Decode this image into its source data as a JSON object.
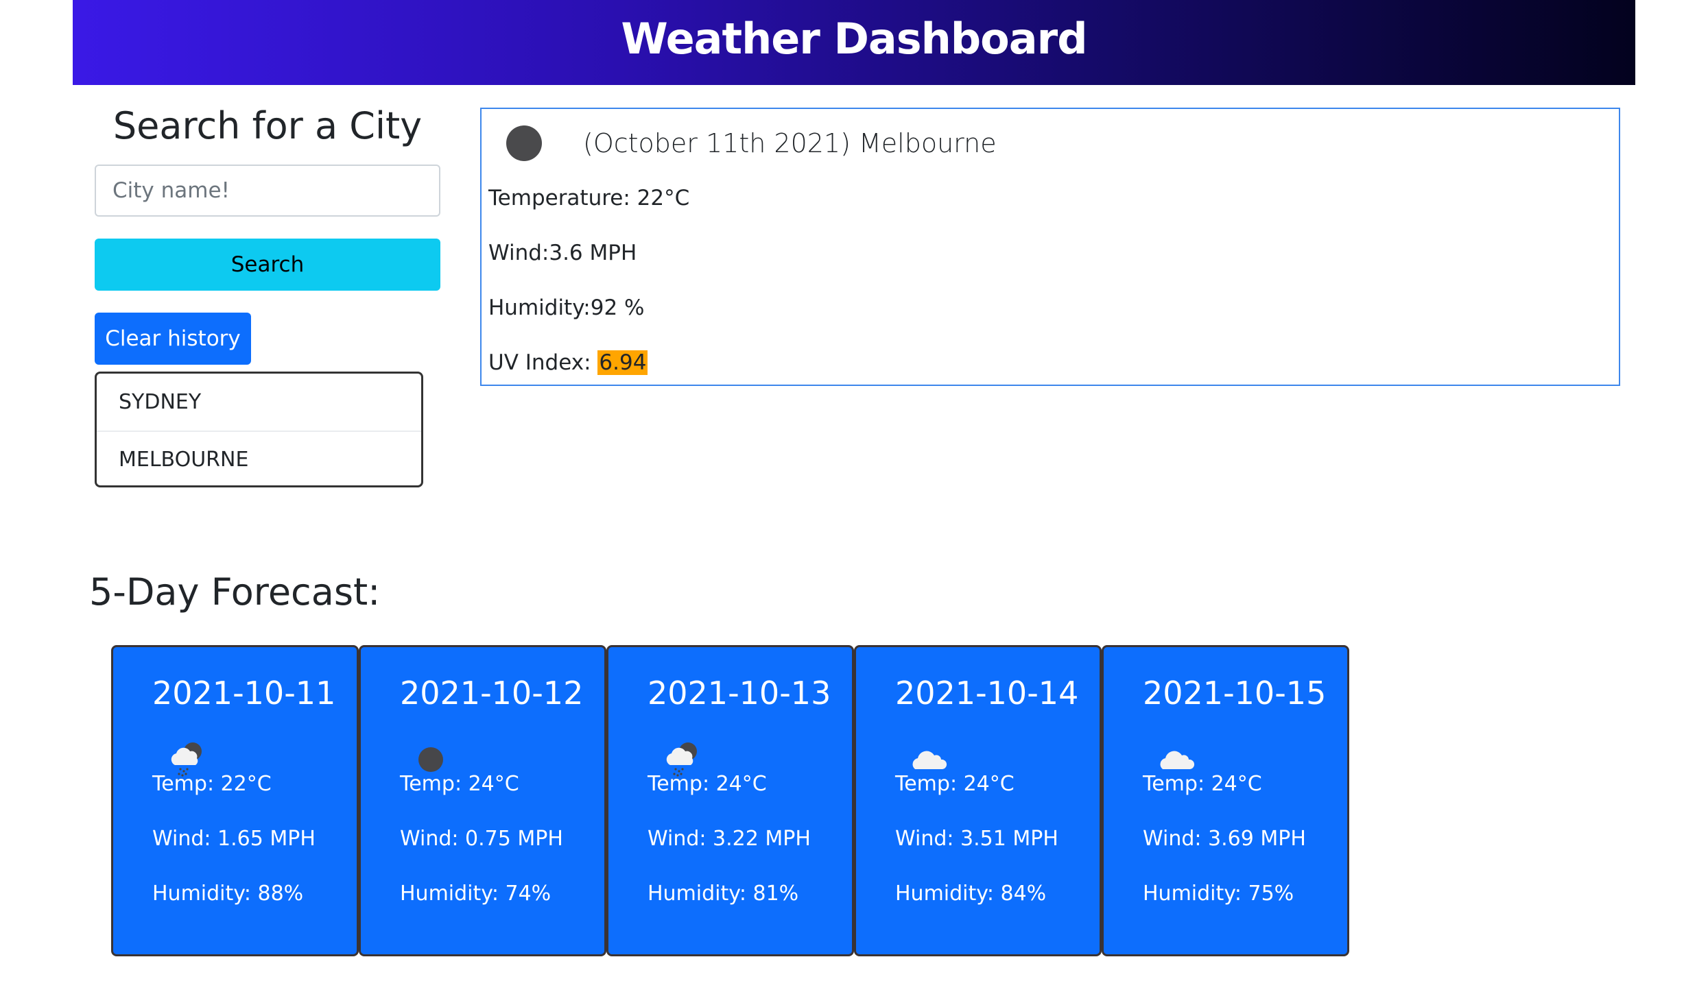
{
  "header": {
    "title": "Weather Dashboard"
  },
  "search": {
    "title": "Search for a City",
    "input_placeholder": "City name!",
    "input_value": "",
    "search_label": "Search",
    "clear_label": "Clear history",
    "history": [
      "SYDNEY",
      "MELBOURNE"
    ]
  },
  "current": {
    "icon": "moon-clear-icon",
    "title": "(October 11th 2021) Melbourne",
    "temperature": "Temperature: 22°C",
    "wind": "Wind:3.6 MPH",
    "humidity": "Humidity:92 %",
    "uv_label": "UV Index: ",
    "uv_value": "6.94",
    "uv_color": "#ffa500"
  },
  "forecast": {
    "title": "5-Day Forecast:",
    "days": [
      {
        "date": "2021-10-11",
        "icon": "cloud-rain-moon-icon",
        "temp": "Temp: 22°C",
        "wind": "Wind: 1.65 MPH",
        "humidity": "Humidity: 88%"
      },
      {
        "date": "2021-10-12",
        "icon": "moon-clear-icon",
        "temp": "Temp: 24°C",
        "wind": "Wind: 0.75 MPH",
        "humidity": "Humidity: 74%"
      },
      {
        "date": "2021-10-13",
        "icon": "cloud-rain-moon-icon",
        "temp": "Temp: 24°C",
        "wind": "Wind: 3.22 MPH",
        "humidity": "Humidity: 81%"
      },
      {
        "date": "2021-10-14",
        "icon": "cloud-icon",
        "temp": "Temp: 24°C",
        "wind": "Wind: 3.51 MPH",
        "humidity": "Humidity: 84%"
      },
      {
        "date": "2021-10-15",
        "icon": "cloud-icon",
        "temp": "Temp: 24°C",
        "wind": "Wind: 3.69 MPH",
        "humidity": "Humidity: 75%"
      }
    ]
  },
  "colors": {
    "card_bg": "#0d6efd",
    "search_button": "#0dcaf0",
    "clear_button": "#0d6efd",
    "current_border": "#3d87ec"
  }
}
